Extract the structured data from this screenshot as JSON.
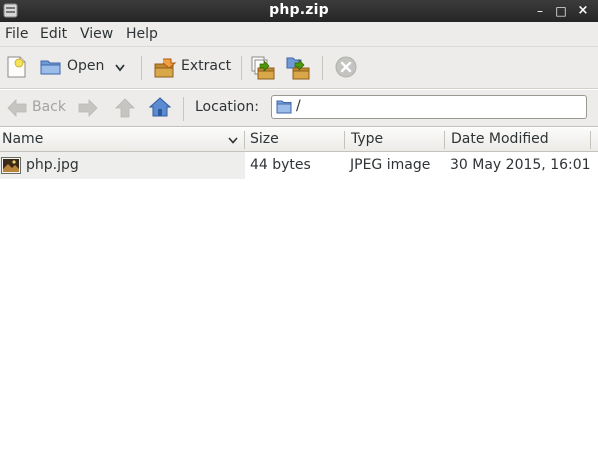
{
  "window": {
    "title": "php.zip",
    "controls": {
      "minimize": "–",
      "maximize": "□",
      "close": "×"
    }
  },
  "menubar": {
    "items": [
      "File",
      "Edit",
      "View",
      "Help"
    ]
  },
  "toolbar": {
    "open_label": "Open",
    "extract_label": "Extract"
  },
  "locationbar": {
    "back_label": "Back",
    "location_label": "Location:",
    "location_value": "/"
  },
  "list": {
    "columns": [
      "Name",
      "Size",
      "Type",
      "Date Modified"
    ],
    "rows": [
      {
        "name": "php.jpg",
        "size": "44 bytes",
        "type": "JPEG image",
        "modified": "30 May 2015, 16:01"
      }
    ]
  },
  "colors": {
    "titlebar": "#2f2f2f",
    "chrome": "#edeceb",
    "selected_cell": "#eeeeec",
    "folder_blue": "#5b8bd0"
  }
}
